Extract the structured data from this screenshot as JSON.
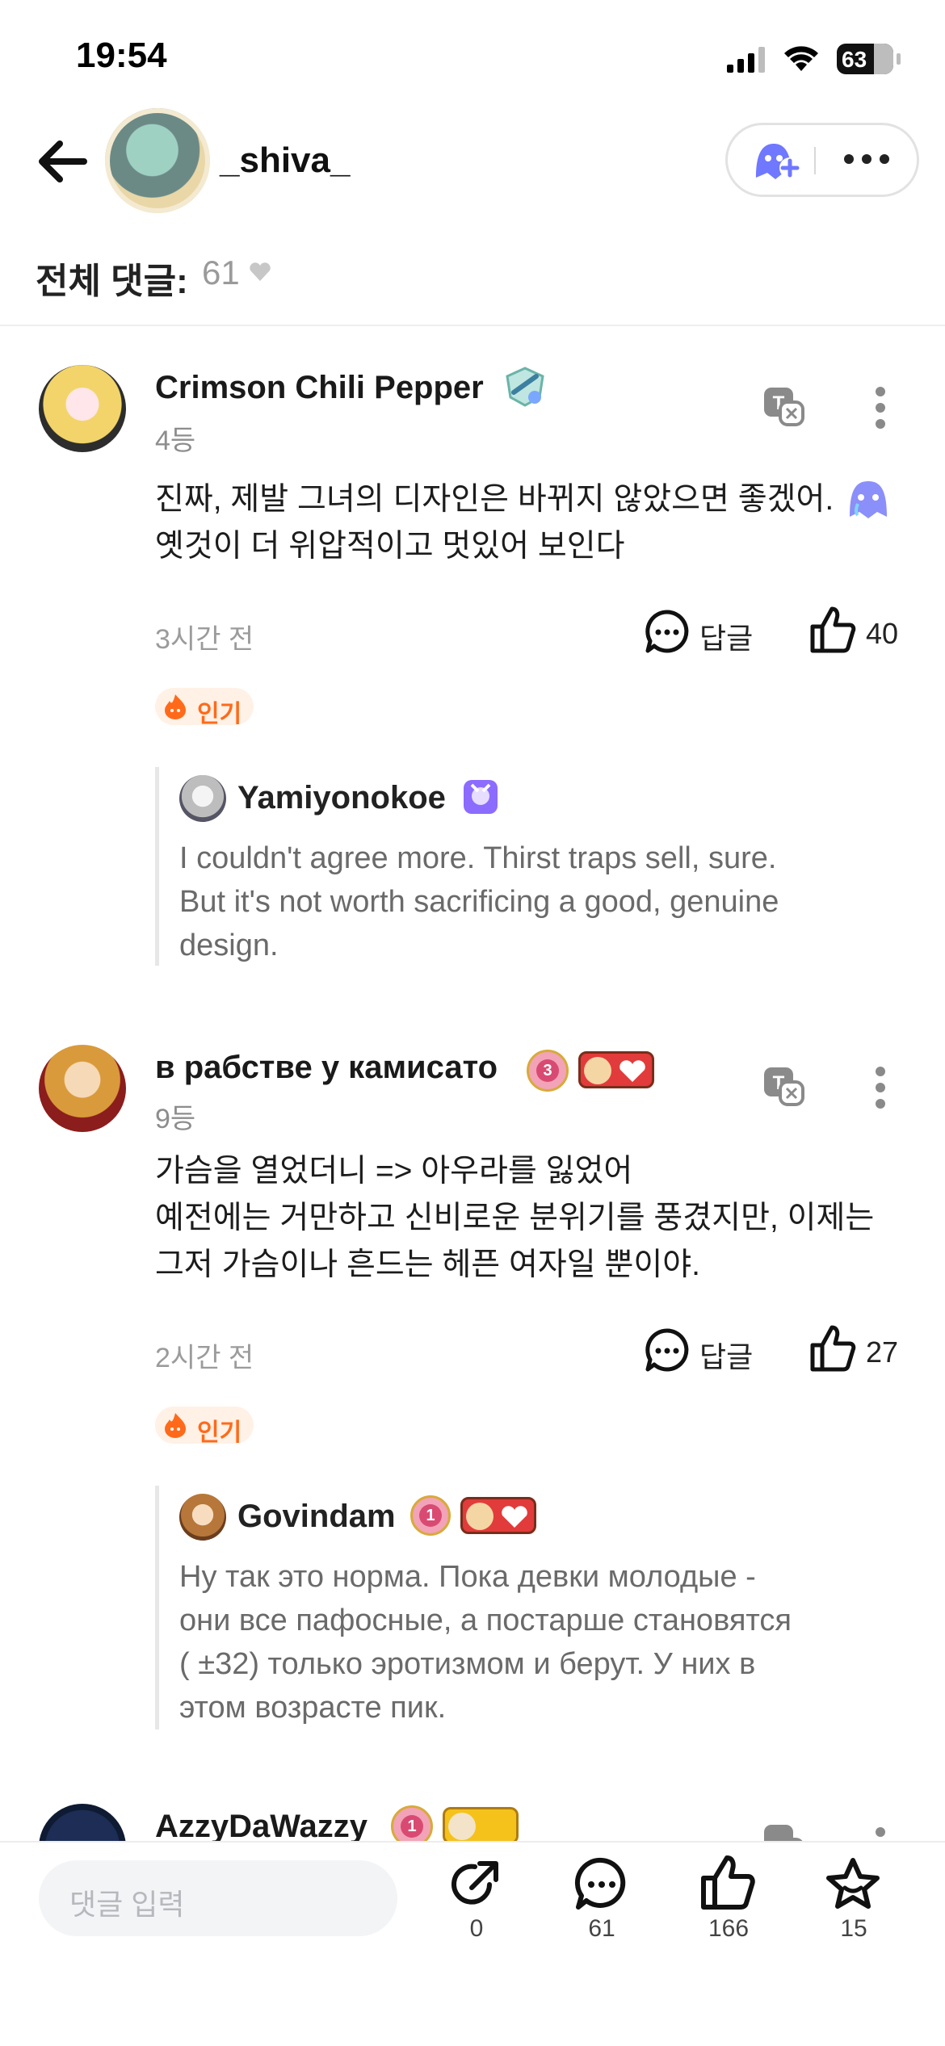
{
  "status_bar": {
    "time": "19:54",
    "battery": "63"
  },
  "header": {
    "author_name": "_shiva_",
    "total_label": "전체 댓글:",
    "total_count": "61"
  },
  "comments": [
    {
      "author": "Crimson Chili Pepper",
      "rank": "4등",
      "text": "진짜, 제발 그녀의 디자인은 바뀌지 않았으면 좋겠어.\n옛것이 더 위압적이고 멋있어 보인다",
      "time": "3시간 전",
      "reply_label": "답글",
      "likes": "40",
      "hot_label": "인기",
      "reply": {
        "author": "Yamiyonokoe",
        "text": "I couldn't agree more. Thirst traps sell, sure.\nBut it's not worth sacrificing a good, genuine\ndesign."
      }
    },
    {
      "author": "в рабстве у камисато",
      "rank": "9등",
      "text": "가슴을 열었더니 => 아우라를 잃었어\n 예전에는 거만하고 신비로운 분위기를 풍겼지만, 이제는\n그저 가슴이나 흔드는 헤픈 여자일 뿐이야.",
      "time": "2시간 전",
      "reply_label": "답글",
      "likes": "27",
      "hot_label": "인기",
      "badge_level": "3",
      "reply": {
        "author": "Govindam",
        "badge_level": "1",
        "text": "Ну так это норма. Пока девки молодые -\nони все пафосные, а постарше становятся\n( ±32) только эротизмом и берут. У них в\nэтом возрасте пик."
      }
    },
    {
      "author": "AzzyDaWazzy",
      "badge_level": "1"
    }
  ],
  "bottom_bar": {
    "input_placeholder": "댓글 입력",
    "share_count": "0",
    "comment_count": "61",
    "like_count": "166",
    "favorite_count": "15"
  },
  "colors": {
    "accent": "#5b6bff",
    "hot": "#ff6a1a",
    "muted": "#9b9b9b"
  }
}
